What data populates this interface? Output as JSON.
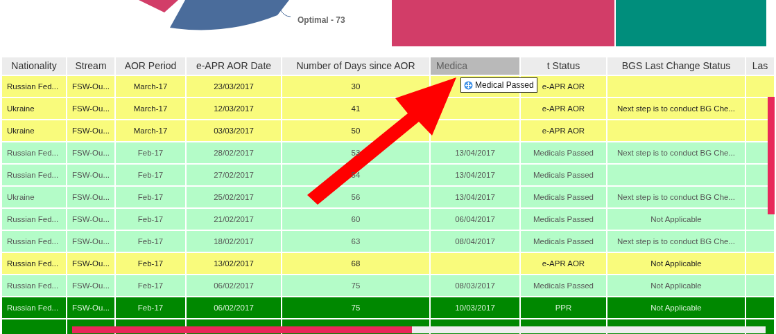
{
  "chart_top": {
    "label": "Optimal - 73"
  },
  "drag_tooltip": {
    "label": "Medical Passed"
  },
  "table": {
    "columns": [
      {
        "label": "Nationality",
        "dragging": false
      },
      {
        "label": "Stream",
        "dragging": false
      },
      {
        "label": "AOR Period",
        "dragging": false
      },
      {
        "label": "e-APR AOR Date",
        "dragging": false
      },
      {
        "label": "Number of Days since AOR",
        "dragging": false
      },
      {
        "label": "Medica",
        "dragging": true
      },
      {
        "label": "t Status",
        "dragging": false
      },
      {
        "label": "BGS Last Change Status",
        "dragging": false
      },
      {
        "label": "Las",
        "dragging": false
      }
    ],
    "rows": [
      {
        "kind": "aor",
        "cells": [
          "Russian Fed...",
          "FSW-Ou...",
          "March-17",
          "23/03/2017",
          "30",
          "",
          "e-APR AOR",
          ""
        ]
      },
      {
        "kind": "aor",
        "cells": [
          "Ukraine",
          "FSW-Ou...",
          "March-17",
          "12/03/2017",
          "41",
          "",
          "e-APR AOR",
          "Next step is to conduct BG Che..."
        ]
      },
      {
        "kind": "aor",
        "cells": [
          "Ukraine",
          "FSW-Ou...",
          "March-17",
          "03/03/2017",
          "50",
          "",
          "e-APR AOR",
          ""
        ]
      },
      {
        "kind": "medical",
        "cells": [
          "Russian Fed...",
          "FSW-Ou...",
          "Feb-17",
          "28/02/2017",
          "53",
          "13/04/2017",
          "Medicals Passed",
          "Next step is to conduct BG Che..."
        ]
      },
      {
        "kind": "medical",
        "cells": [
          "Russian Fed...",
          "FSW-Ou...",
          "Feb-17",
          "27/02/2017",
          "54",
          "13/04/2017",
          "Medicals Passed",
          ""
        ]
      },
      {
        "kind": "medical",
        "cells": [
          "Ukraine",
          "FSW-Ou...",
          "Feb-17",
          "25/02/2017",
          "56",
          "13/04/2017",
          "Medicals Passed",
          "Next step is to conduct BG Che..."
        ]
      },
      {
        "kind": "medical",
        "cells": [
          "Russian Fed...",
          "FSW-Ou...",
          "Feb-17",
          "21/02/2017",
          "60",
          "06/04/2017",
          "Medicals Passed",
          "Not Applicable"
        ]
      },
      {
        "kind": "medical",
        "cells": [
          "Russian Fed...",
          "FSW-Ou...",
          "Feb-17",
          "18/02/2017",
          "63",
          "08/04/2017",
          "Medicals Passed",
          "Next step is to conduct BG Che..."
        ]
      },
      {
        "kind": "aor",
        "cells": [
          "Russian Fed...",
          "FSW-Ou...",
          "Feb-17",
          "13/02/2017",
          "68",
          "",
          "e-APR AOR",
          "Not Applicable"
        ]
      },
      {
        "kind": "medical",
        "cells": [
          "Russian Fed...",
          "FSW-Ou...",
          "Feb-17",
          "06/02/2017",
          "75",
          "08/03/2017",
          "Medicals Passed",
          "Not Applicable"
        ]
      },
      {
        "kind": "ppr",
        "cells": [
          "Russian Fed...",
          "FSW-Ou...",
          "Feb-17",
          "06/02/2017",
          "75",
          "10/03/2017",
          "PPR",
          "Not Applicable"
        ]
      },
      {
        "kind": "ppr",
        "cells": [
          "",
          "",
          "",
          "",
          "",
          "",
          "",
          ""
        ]
      }
    ]
  }
}
